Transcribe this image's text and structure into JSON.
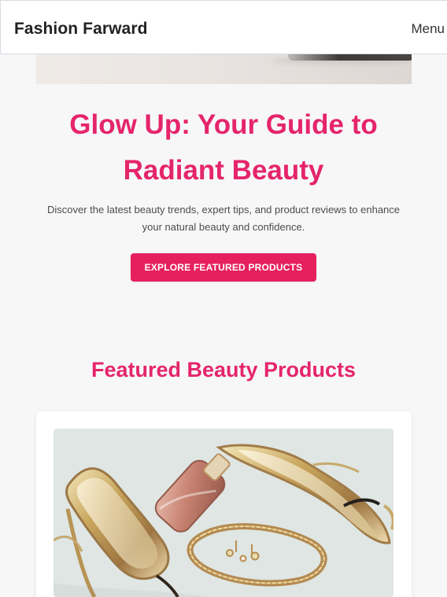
{
  "header": {
    "brand": "Fashion Farward",
    "menu_label": "Menu"
  },
  "hero": {
    "title": "Glow Up: Your Guide to Radiant Beauty",
    "subtitle": "Discover the latest beauty trends, expert tips, and product reviews to enhance your natural beauty and confidence.",
    "button_label": "EXPLORE FEATURED PRODUCTS"
  },
  "featured": {
    "title": "Featured Beauty Products"
  },
  "colors": {
    "accent": "#e5256a",
    "button": "#e6205f",
    "background": "#f7f7f8"
  }
}
